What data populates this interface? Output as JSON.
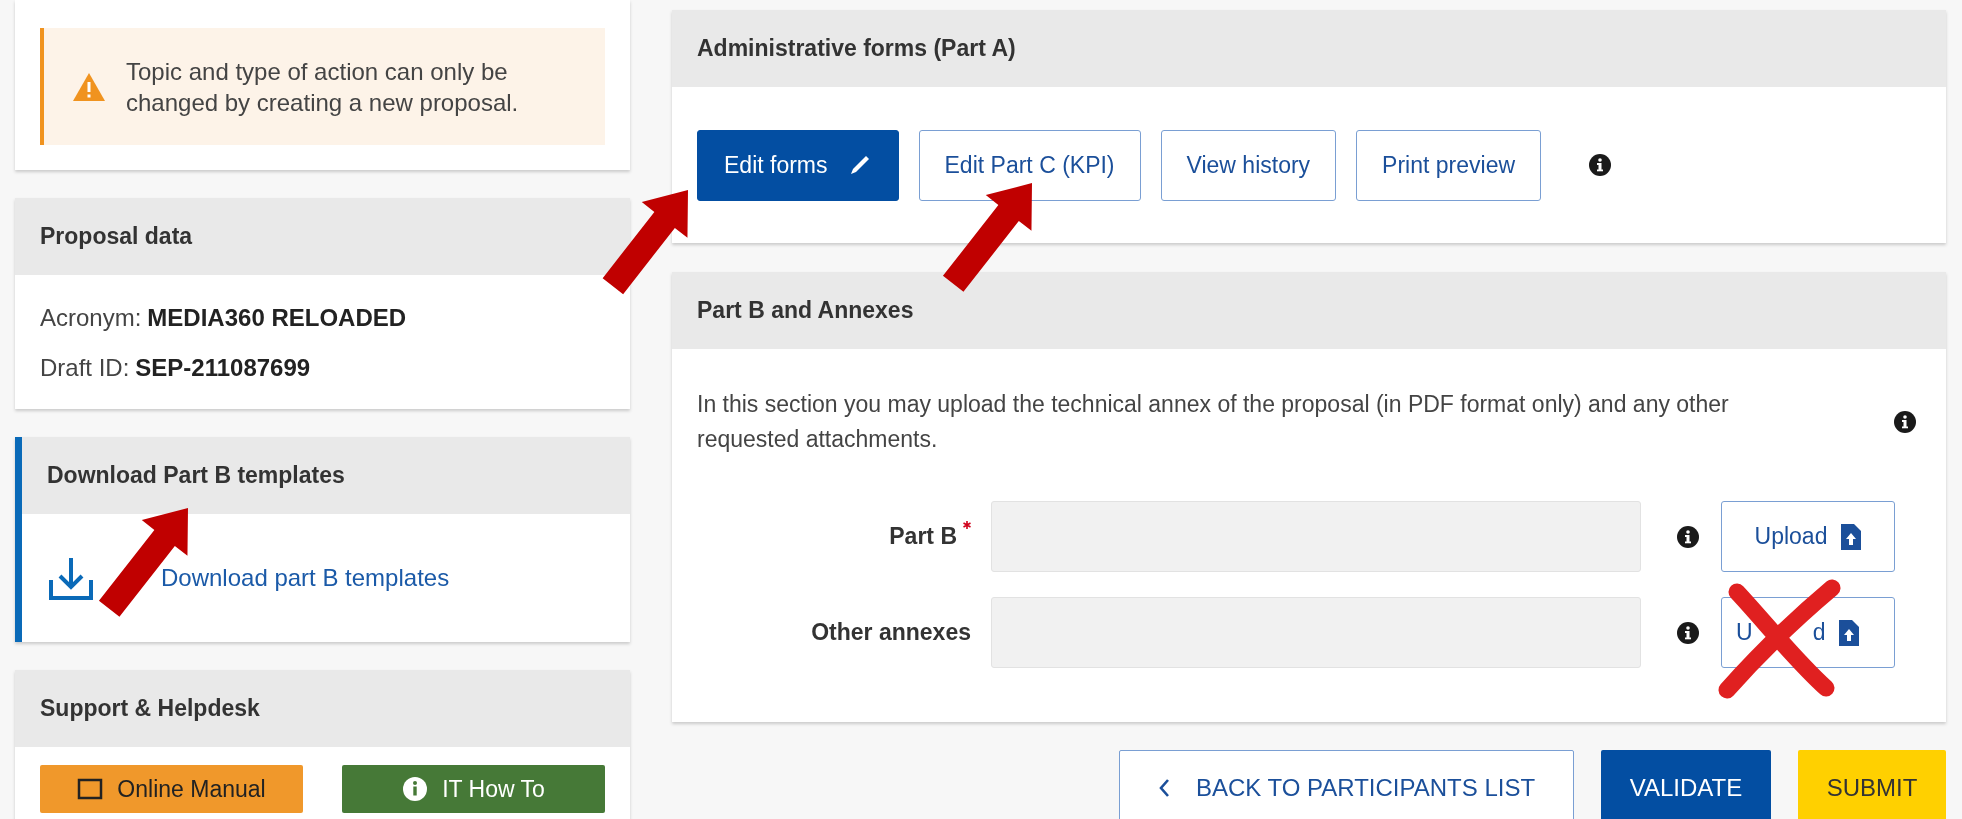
{
  "notice": {
    "text": "Topic and type of action can only be changed by creating a new proposal."
  },
  "proposal_data": {
    "title": "Proposal data",
    "fields": [
      {
        "label": "Acronym:",
        "value": "MEDIA360 RELOADED"
      },
      {
        "label": "Draft ID:",
        "value": "SEP-211087699"
      }
    ]
  },
  "download_card": {
    "title": "Download Part B templates",
    "link": "Download part B templates"
  },
  "support": {
    "title": "Support & Helpdesk",
    "buttons": [
      {
        "label": "Online Manual",
        "kind": "manual"
      },
      {
        "label": "IT How To",
        "kind": "info"
      }
    ]
  },
  "admin_forms": {
    "title": "Administrative forms (Part A)",
    "buttons": [
      {
        "label": "Edit forms",
        "kind": "primary"
      },
      {
        "label": "Edit Part C (KPI)",
        "kind": "outline"
      },
      {
        "label": "View history",
        "kind": "outline"
      },
      {
        "label": "Print preview",
        "kind": "outline"
      }
    ]
  },
  "part_b": {
    "title": "Part B and Annexes",
    "description": "In this section you may upload the technical annex of the proposal (in PDF format only) and any other requested attachments.",
    "rows": [
      {
        "label": "Part B",
        "required": true,
        "button": "Upload"
      },
      {
        "label": "Other annexes",
        "required": false,
        "button_parts": [
          "U",
          "d"
        ]
      }
    ]
  },
  "footer_buttons": [
    {
      "label": "BACK TO PARTICIPANTS LIST",
      "kind": "back"
    },
    {
      "label": "VALIDATE",
      "kind": "primary"
    },
    {
      "label": "SUBMIT",
      "kind": "submit"
    }
  ]
}
